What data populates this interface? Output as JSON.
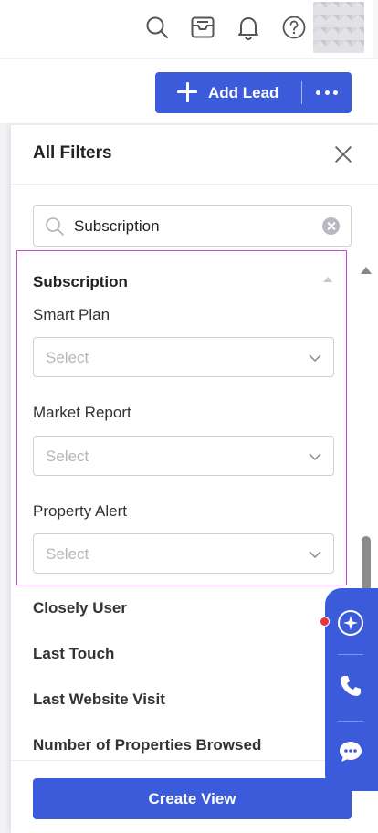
{
  "header": {
    "icons": [
      "search-icon",
      "inbox-icon",
      "bell-icon",
      "help-icon"
    ]
  },
  "actions": {
    "add_lead_label": "Add Lead"
  },
  "panel": {
    "title": "All Filters",
    "search": {
      "value": "Subscription"
    },
    "section": {
      "title": "Subscription",
      "fields": [
        {
          "label": "Smart Plan",
          "placeholder": "Select"
        },
        {
          "label": "Market Report",
          "placeholder": "Select"
        },
        {
          "label": "Property Alert",
          "placeholder": "Select"
        }
      ]
    },
    "items": [
      "Closely User",
      "Last Touch",
      "Last Website Visit",
      "Number of Properties Browsed"
    ],
    "create_view_label": "Create View"
  },
  "colors": {
    "primary": "#3b5bdb",
    "section_outline": "#cc44dd",
    "notification": "#e5383b"
  }
}
